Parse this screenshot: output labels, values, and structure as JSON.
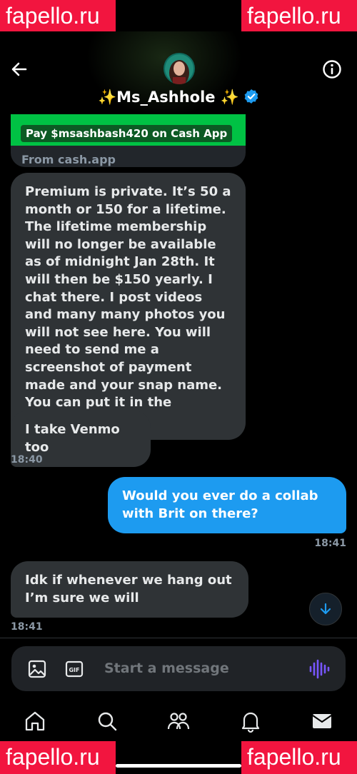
{
  "watermark": "fapello.ru",
  "header": {
    "name": "✨Ms_Ashhole ✨",
    "back_icon": "arrow-left-icon",
    "info_icon": "info-icon",
    "verified_icon": "verified-badge-icon",
    "accent": "#1d9bf0"
  },
  "card": {
    "pay_label": "Pay $msashbash420 on Cash App",
    "source": "From cash.app",
    "brand_color": "#00c244"
  },
  "messages": [
    {
      "direction": "in",
      "text": "Premium is private. It’s 50 a month or 150 for a lifetime. The lifetime membership will no longer be available as of midnight Jan 28th. It will then be $150 yearly. I chat there. I post videos and many many photos you will not see here. You will need to send me a screenshot of payment made and your snap name. You can put it in the payment too."
    },
    {
      "direction": "in",
      "text": "I take Venmo too",
      "time": "18:40"
    },
    {
      "direction": "out",
      "text": "Would you ever do a collab with Brit on there?",
      "time": "18:41"
    },
    {
      "direction": "in",
      "text": "Idk if whenever we hang out I’m sure we will",
      "time": "18:41"
    }
  ],
  "composer": {
    "placeholder": "Start a message",
    "image_icon": "image-icon",
    "gif_icon": "gif-icon",
    "voice_icon": "voice-waveform-icon",
    "voice_color": "#7856ff"
  },
  "nav": {
    "tabs": [
      "home-icon",
      "search-icon",
      "communities-icon",
      "notifications-icon",
      "messages-icon"
    ]
  }
}
